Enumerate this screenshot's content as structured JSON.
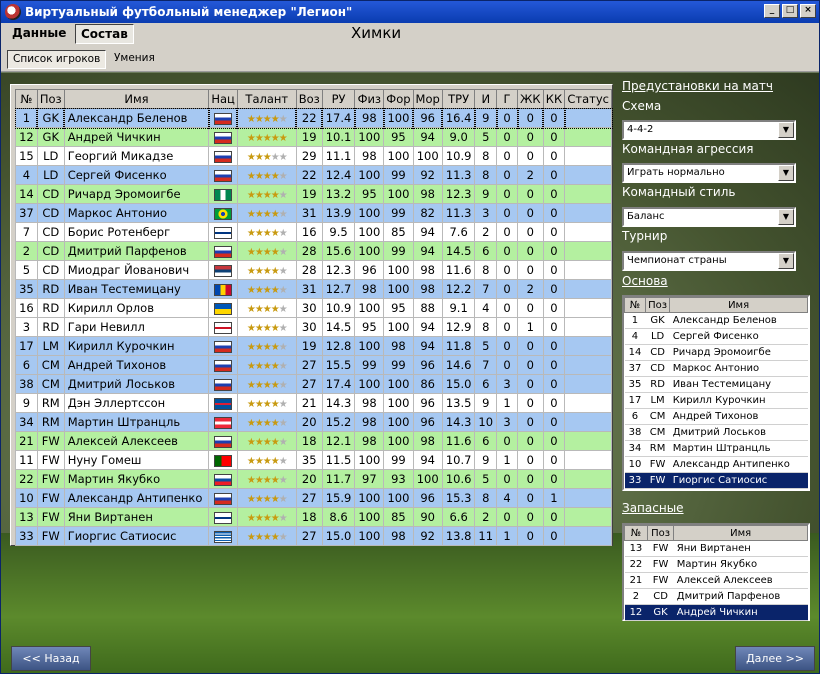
{
  "window": {
    "title": "Виртуальный футбольный менеджер \"Легион\""
  },
  "menu": {
    "tabs": [
      "Данные",
      "Состав"
    ],
    "active": "Состав"
  },
  "club_name": "Химки",
  "subtabs": [
    "Список игроков",
    "Умения"
  ],
  "roster": {
    "columns": [
      "№",
      "Поз",
      "Имя",
      "Нац",
      "Талант",
      "Воз",
      "РУ",
      "Физ",
      "Фор",
      "Мор",
      "ТРУ",
      "И",
      "Г",
      "ЖК",
      "КК",
      "Статус"
    ],
    "rows": [
      {
        "num": "1",
        "pos": "GK",
        "name": "Александр Беленов",
        "flag": "ru",
        "talent": 4,
        "age": "22",
        "ru": "17.4",
        "fiz": "98",
        "for": "100",
        "mor": "96",
        "tru": "16.4",
        "i": "9",
        "g": "0",
        "yk": "0",
        "kk": "0",
        "status": "",
        "row": "blue"
      },
      {
        "num": "12",
        "pos": "GK",
        "name": "Андрей Чичкин",
        "flag": "ru",
        "talent": 5,
        "age": "19",
        "ru": "10.1",
        "fiz": "100",
        "for": "95",
        "mor": "94",
        "tru": "9.0",
        "i": "5",
        "g": "0",
        "yk": "0",
        "kk": "0",
        "status": "",
        "row": "green"
      },
      {
        "num": "15",
        "pos": "LD",
        "name": "Георгий Микадзе",
        "flag": "ru",
        "talent": 3,
        "age": "29",
        "ru": "11.1",
        "fiz": "98",
        "for": "100",
        "mor": "100",
        "tru": "10.9",
        "i": "8",
        "g": "0",
        "yk": "0",
        "kk": "0",
        "status": "",
        "row": "white"
      },
      {
        "num": "4",
        "pos": "LD",
        "name": "Сергей Фисенко",
        "flag": "ru",
        "talent": 4,
        "age": "22",
        "ru": "12.4",
        "fiz": "100",
        "for": "99",
        "mor": "92",
        "tru": "11.3",
        "i": "8",
        "g": "0",
        "yk": "2",
        "kk": "0",
        "status": "",
        "row": "blue"
      },
      {
        "num": "14",
        "pos": "CD",
        "name": "Ричард Эромоигбе",
        "flag": "ng",
        "talent": 4,
        "age": "19",
        "ru": "13.2",
        "fiz": "95",
        "for": "100",
        "mor": "98",
        "tru": "12.3",
        "i": "9",
        "g": "0",
        "yk": "0",
        "kk": "0",
        "status": "",
        "row": "green"
      },
      {
        "num": "37",
        "pos": "CD",
        "name": "Маркос Антонио",
        "flag": "br",
        "talent": 4,
        "age": "31",
        "ru": "13.9",
        "fiz": "100",
        "for": "99",
        "mor": "82",
        "tru": "11.3",
        "i": "3",
        "g": "0",
        "yk": "0",
        "kk": "0",
        "status": "",
        "row": "blue"
      },
      {
        "num": "7",
        "pos": "CD",
        "name": "Борис Ротенберг",
        "flag": "fi",
        "talent": 4,
        "age": "16",
        "ru": "9.5",
        "fiz": "100",
        "for": "85",
        "mor": "94",
        "tru": "7.6",
        "i": "2",
        "g": "0",
        "yk": "0",
        "kk": "0",
        "status": "",
        "row": "white"
      },
      {
        "num": "2",
        "pos": "CD",
        "name": "Дмитрий Парфенов",
        "flag": "ru",
        "talent": 4,
        "age": "28",
        "ru": "15.6",
        "fiz": "100",
        "for": "99",
        "mor": "94",
        "tru": "14.5",
        "i": "6",
        "g": "0",
        "yk": "0",
        "kk": "0",
        "status": "",
        "row": "green"
      },
      {
        "num": "5",
        "pos": "CD",
        "name": "Миодраг Йованович",
        "flag": "rs",
        "talent": 4,
        "age": "28",
        "ru": "12.3",
        "fiz": "96",
        "for": "100",
        "mor": "98",
        "tru": "11.6",
        "i": "8",
        "g": "0",
        "yk": "0",
        "kk": "0",
        "status": "",
        "row": "white"
      },
      {
        "num": "35",
        "pos": "RD",
        "name": "Иван Тестемицану",
        "flag": "md",
        "talent": 4,
        "age": "31",
        "ru": "12.7",
        "fiz": "98",
        "for": "100",
        "mor": "98",
        "tru": "12.2",
        "i": "7",
        "g": "0",
        "yk": "2",
        "kk": "0",
        "status": "",
        "row": "blue"
      },
      {
        "num": "16",
        "pos": "RD",
        "name": "Кирилл Орлов",
        "flag": "ua",
        "talent": 4,
        "age": "30",
        "ru": "10.9",
        "fiz": "100",
        "for": "95",
        "mor": "88",
        "tru": "9.1",
        "i": "4",
        "g": "0",
        "yk": "0",
        "kk": "0",
        "status": "",
        "row": "white"
      },
      {
        "num": "3",
        "pos": "RD",
        "name": "Гари Невилл",
        "flag": "en",
        "talent": 4,
        "age": "30",
        "ru": "14.5",
        "fiz": "95",
        "for": "100",
        "mor": "94",
        "tru": "12.9",
        "i": "8",
        "g": "0",
        "yk": "1",
        "kk": "0",
        "status": "",
        "row": "white"
      },
      {
        "num": "17",
        "pos": "LM",
        "name": "Кирилл Курочкин",
        "flag": "ru",
        "talent": 4,
        "age": "19",
        "ru": "12.8",
        "fiz": "100",
        "for": "98",
        "mor": "94",
        "tru": "11.8",
        "i": "5",
        "g": "0",
        "yk": "0",
        "kk": "0",
        "status": "",
        "row": "blue"
      },
      {
        "num": "6",
        "pos": "CM",
        "name": "Андрей Тихонов",
        "flag": "ru",
        "talent": 4,
        "age": "27",
        "ru": "15.5",
        "fiz": "99",
        "for": "99",
        "mor": "96",
        "tru": "14.6",
        "i": "7",
        "g": "0",
        "yk": "0",
        "kk": "0",
        "status": "",
        "row": "blue"
      },
      {
        "num": "38",
        "pos": "CM",
        "name": "Дмитрий Лоськов",
        "flag": "ru",
        "talent": 4,
        "age": "27",
        "ru": "17.4",
        "fiz": "100",
        "for": "100",
        "mor": "86",
        "tru": "15.0",
        "i": "6",
        "g": "3",
        "yk": "0",
        "kk": "0",
        "status": "",
        "row": "blue"
      },
      {
        "num": "9",
        "pos": "RM",
        "name": "Дэн Эллертссон",
        "flag": "is",
        "talent": 4,
        "age": "21",
        "ru": "14.3",
        "fiz": "98",
        "for": "100",
        "mor": "96",
        "tru": "13.5",
        "i": "9",
        "g": "1",
        "yk": "0",
        "kk": "0",
        "status": "",
        "row": "white"
      },
      {
        "num": "34",
        "pos": "RM",
        "name": "Мартин Штранцль",
        "flag": "at",
        "talent": 4,
        "age": "20",
        "ru": "15.2",
        "fiz": "98",
        "for": "100",
        "mor": "96",
        "tru": "14.3",
        "i": "10",
        "g": "3",
        "yk": "0",
        "kk": "0",
        "status": "",
        "row": "blue"
      },
      {
        "num": "21",
        "pos": "FW",
        "name": "Алексей Алексеев",
        "flag": "ru",
        "talent": 4,
        "age": "18",
        "ru": "12.1",
        "fiz": "98",
        "for": "100",
        "mor": "98",
        "tru": "11.6",
        "i": "6",
        "g": "0",
        "yk": "0",
        "kk": "0",
        "status": "",
        "row": "green"
      },
      {
        "num": "11",
        "pos": "FW",
        "name": "Нуну Гомеш",
        "flag": "pt",
        "talent": 4,
        "age": "35",
        "ru": "11.5",
        "fiz": "100",
        "for": "99",
        "mor": "94",
        "tru": "10.7",
        "i": "9",
        "g": "1",
        "yk": "0",
        "kk": "0",
        "status": "",
        "row": "white"
      },
      {
        "num": "22",
        "pos": "FW",
        "name": "Мартин Якубко",
        "flag": "sk",
        "talent": 4,
        "age": "20",
        "ru": "11.7",
        "fiz": "97",
        "for": "93",
        "mor": "100",
        "tru": "10.6",
        "i": "5",
        "g": "0",
        "yk": "0",
        "kk": "0",
        "status": "",
        "row": "green"
      },
      {
        "num": "10",
        "pos": "FW",
        "name": "Александр Антипенко",
        "flag": "ru",
        "talent": 4,
        "age": "27",
        "ru": "15.9",
        "fiz": "100",
        "for": "100",
        "mor": "96",
        "tru": "15.3",
        "i": "8",
        "g": "4",
        "yk": "0",
        "kk": "1",
        "status": "",
        "row": "blue"
      },
      {
        "num": "13",
        "pos": "FW",
        "name": "Яни Виртанен",
        "flag": "fi",
        "talent": 4,
        "age": "18",
        "ru": "8.6",
        "fiz": "100",
        "for": "85",
        "mor": "90",
        "tru": "6.6",
        "i": "2",
        "g": "0",
        "yk": "0",
        "kk": "0",
        "status": "",
        "row": "green"
      },
      {
        "num": "33",
        "pos": "FW",
        "name": "Гиоргис Сатиосис",
        "flag": "gr",
        "talent": 4,
        "age": "27",
        "ru": "15.0",
        "fiz": "100",
        "for": "98",
        "mor": "92",
        "tru": "13.8",
        "i": "11",
        "g": "1",
        "yk": "0",
        "kk": "0",
        "status": "",
        "row": "blue"
      }
    ]
  },
  "match_settings": {
    "header": "Предустановки на матч",
    "scheme_label": "Схема",
    "scheme_value": "4-4-2",
    "aggression_label": "Командная агрессия",
    "aggression_value": "Играть нормально",
    "style_label": "Командный стиль",
    "style_value": "Баланс",
    "tournament_label": "Турнир",
    "tournament_value": "Чемпионат страны"
  },
  "starting": {
    "header": "Основа",
    "columns": [
      "№",
      "Поз",
      "Имя"
    ],
    "rows": [
      [
        "1",
        "GK",
        "Александр Беленов"
      ],
      [
        "4",
        "LD",
        "Сергей Фисенко"
      ],
      [
        "14",
        "CD",
        "Ричард Эромоигбе"
      ],
      [
        "37",
        "CD",
        "Маркос Антонио"
      ],
      [
        "35",
        "RD",
        "Иван Тестемицану"
      ],
      [
        "17",
        "LM",
        "Кирилл Курочкин"
      ],
      [
        "6",
        "CM",
        "Андрей Тихонов"
      ],
      [
        "38",
        "CM",
        "Дмитрий Лоськов"
      ],
      [
        "34",
        "RM",
        "Мартин Штранцль"
      ],
      [
        "10",
        "FW",
        "Александр Антипенко"
      ],
      [
        "33",
        "FW",
        "Гиоргис Сатиосис"
      ]
    ],
    "selected_index": 10
  },
  "subs": {
    "header": "Запасные",
    "columns": [
      "№",
      "Поз",
      "Имя"
    ],
    "rows": [
      [
        "13",
        "FW",
        "Яни Виртанен"
      ],
      [
        "22",
        "FW",
        "Мартин Якубко"
      ],
      [
        "21",
        "FW",
        "Алексей Алексеев"
      ],
      [
        "2",
        "CD",
        "Дмитрий Парфенов"
      ],
      [
        "12",
        "GK",
        "Андрей Чичкин"
      ]
    ],
    "selected_index": 4
  },
  "nav": {
    "back": "<< Назад",
    "next": "Далее >>"
  },
  "colors": {
    "row_blue": "#a6c8f2",
    "row_green": "#b4f0a0",
    "selection": "#0a246a"
  }
}
